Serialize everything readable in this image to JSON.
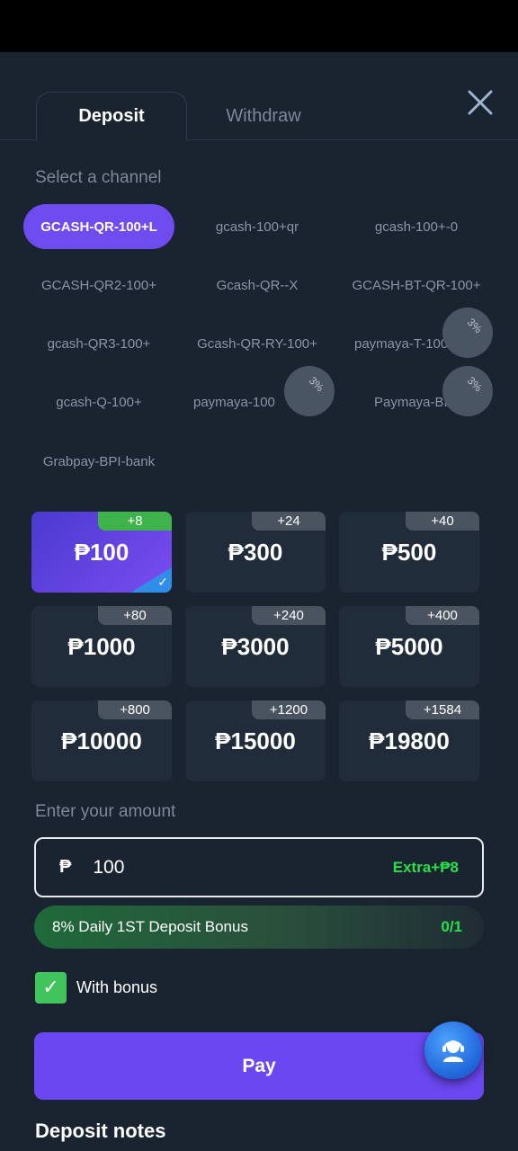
{
  "tabs": {
    "deposit": "Deposit",
    "withdraw": "Withdraw"
  },
  "channel_label": "Select a channel",
  "channels": [
    {
      "label": "GCASH-QR-100+L",
      "tag": ""
    },
    {
      "label": "gcash-100+qr",
      "tag": ""
    },
    {
      "label": "gcash-100+-0",
      "tag": ""
    },
    {
      "label": "GCASH-QR2-100+",
      "tag": ""
    },
    {
      "label": "Gcash-QR--X",
      "tag": ""
    },
    {
      "label": "GCASH-BT-QR-100+",
      "tag": ""
    },
    {
      "label": "gcash-QR3-100+",
      "tag": ""
    },
    {
      "label": "Gcash-QR-RY-100+",
      "tag": ""
    },
    {
      "label": "paymaya-T-100",
      "tag": "3%"
    },
    {
      "label": "gcash-Q-100+",
      "tag": ""
    },
    {
      "label": "paymaya-100",
      "tag": "3%"
    },
    {
      "label": "Paymaya-BI",
      "tag": "3%"
    },
    {
      "label": "Grabpay-BPI-bank",
      "tag": ""
    }
  ],
  "amounts": [
    {
      "value": "₱100",
      "bonus": "+8"
    },
    {
      "value": "₱300",
      "bonus": "+24"
    },
    {
      "value": "₱500",
      "bonus": "+40"
    },
    {
      "value": "₱1000",
      "bonus": "+80"
    },
    {
      "value": "₱3000",
      "bonus": "+240"
    },
    {
      "value": "₱5000",
      "bonus": "+400"
    },
    {
      "value": "₱10000",
      "bonus": "+800"
    },
    {
      "value": "₱15000",
      "bonus": "+1200"
    },
    {
      "value": "₱19800",
      "bonus": "+1584"
    }
  ],
  "amount_label": "Enter your amount",
  "amount_input": {
    "currency": "₱",
    "value": "100",
    "extra": "Extra+₱8"
  },
  "bonus_bar": {
    "text": "8% Daily 1ST Deposit Bonus",
    "count": "0/1"
  },
  "with_bonus": {
    "label": "With bonus",
    "checked": true
  },
  "pay_label": "Pay",
  "notes_title": "Deposit notes",
  "colors": {
    "accent": "#6a47f0",
    "success": "#29e04a",
    "background": "#1a2330"
  }
}
